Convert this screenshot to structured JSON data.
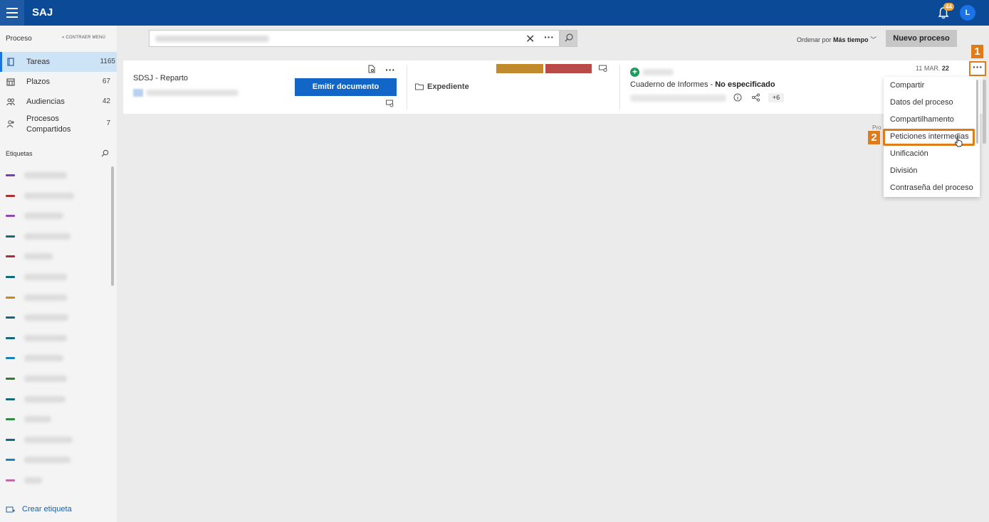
{
  "app": {
    "title": "SAJ",
    "notification_count": "44",
    "user_initial": "L"
  },
  "sidebar": {
    "heading": "Proceso",
    "collapse_label": "« CONTRAER MENÚ",
    "nav": [
      {
        "label": "Tareas",
        "count": "1165",
        "active": true,
        "icon": "tasks-icon"
      },
      {
        "label": "Plazos",
        "count": "67",
        "icon": "calendar-icon"
      },
      {
        "label": "Audiencias",
        "count": "42",
        "icon": "people-icon"
      },
      {
        "label": "Procesos Compartidos",
        "count": "7",
        "icon": "shared-people-icon"
      }
    ],
    "labels_heading": "Etiquetas",
    "tag_colors": [
      "#7b3fa8",
      "#a83232",
      "#8b4bb0",
      "#15697a",
      "#a83232",
      "#15697a",
      "#c48a1d",
      "#15697a",
      "#15697a",
      "#1a82b5",
      "#2e7d32",
      "#15697a",
      "#2e8b40",
      "#15697a",
      "#1a82b5",
      "#c06aa8"
    ],
    "create_label": "Crear etiqueta"
  },
  "toolbar": {
    "search_value": "",
    "sort_prefix": "Ordenar por",
    "sort_value": "Más tiempo",
    "new_process": "Nuevo proceso"
  },
  "card": {
    "title": "SDSJ - Reparto",
    "emit_button": "Emitir documento",
    "expediente": "Expediente",
    "cuaderno_label": "Cuaderno de Informes -",
    "cuaderno_value": "No especificado",
    "extra_count": "+6",
    "date_day": "11 MAR.",
    "date_year": "22",
    "peek": "Pro"
  },
  "dropdown": {
    "items": [
      "Compartir",
      "Datos del proceso",
      "Compartilhamento",
      "Peticiones intermedias",
      "Unificación",
      "División",
      "Contraseña del proceso"
    ]
  },
  "markers": {
    "one": "1",
    "two": "2"
  },
  "colors": {
    "accent": "#0a4a96",
    "button": "#1266c8",
    "highlight": "#e07b1a"
  }
}
